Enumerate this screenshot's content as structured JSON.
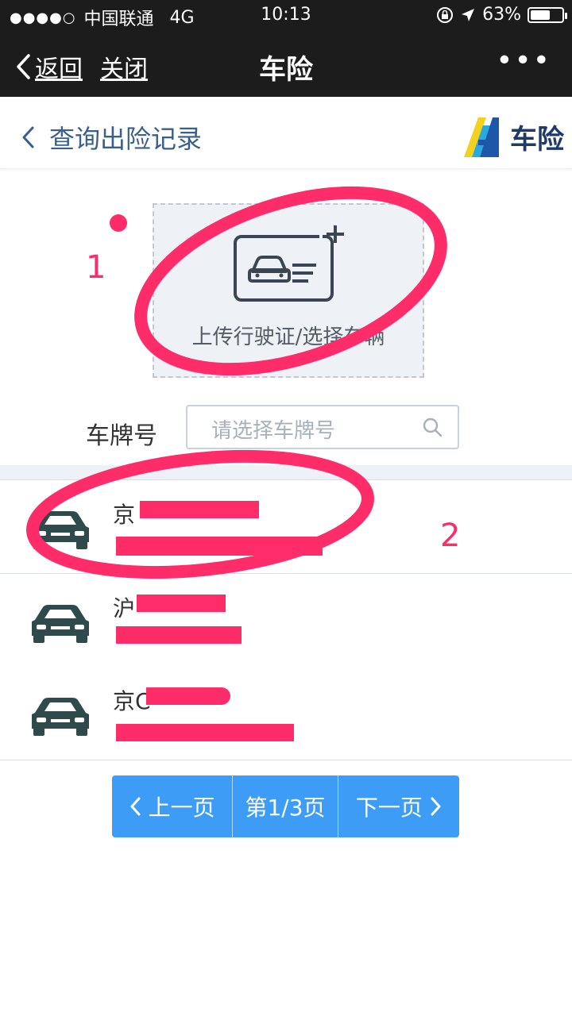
{
  "status_bar": {
    "signal_dots": "●●●●○",
    "carrier": "中国联通",
    "network": "4G",
    "time": "10:13",
    "battery_percent": "63%",
    "battery_level": 0.63,
    "icons": [
      "signal-dots-icon",
      "rotation-lock-icon",
      "location-arrow-icon",
      "battery-icon"
    ]
  },
  "nav_bar": {
    "back_label": "返回",
    "close_label": "关闭",
    "title": "车险",
    "more_label": "•••"
  },
  "sub_header": {
    "back_label": "查询出险记录",
    "brand_text": "车险",
    "brand_logo": "A"
  },
  "upload": {
    "label": "上传行驶证/选择车辆",
    "visible_label": "上传行驶证/选择车辆",
    "icon": "vehicle-license-add-icon"
  },
  "annotations": {
    "marker_1": "1",
    "marker_2": "2",
    "color": "#ff2c6a"
  },
  "plate_search": {
    "label": "车牌号",
    "placeholder": "请选择车牌号",
    "icon": "search-icon"
  },
  "vehicles": [
    {
      "plate_prefix": "京"
    },
    {
      "plate_prefix": "沪"
    },
    {
      "plate_prefix": "京C"
    }
  ],
  "pagination": {
    "prev_label": "上一页",
    "current": "第1/3页",
    "next_label": "下一页"
  },
  "colors": {
    "header_bg": "#1c1c1c",
    "accent_blue": "#3d9cf5",
    "link_blue": "#3a5f8c",
    "annotation_pink": "#ff2c6a",
    "car_icon": "#2e4a4a"
  }
}
